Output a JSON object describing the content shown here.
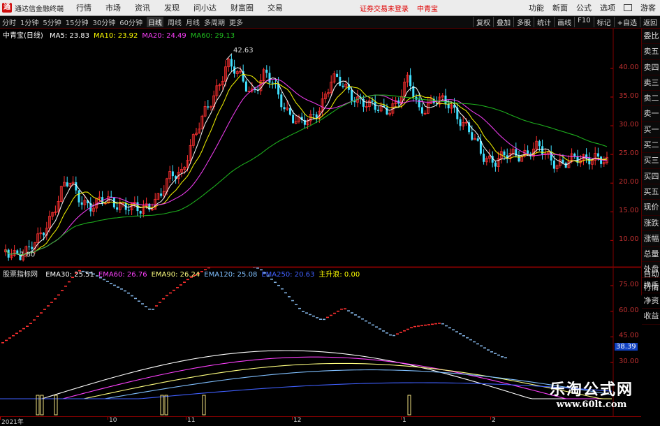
{
  "menubar": {
    "app_title": "通达信金融终端",
    "items": [
      "行情",
      "市场",
      "资讯",
      "发现",
      "问小达",
      "财富圈",
      "交易"
    ],
    "notice": "证券交易未登录",
    "stock": "中青宝",
    "right": [
      "功能",
      "新面",
      "公式",
      "选项",
      "",
      "游客"
    ]
  },
  "periodbar": {
    "periods": [
      "分时",
      "1分钟",
      "5分钟",
      "15分钟",
      "30分钟",
      "60分钟",
      "日线",
      "周线",
      "月线",
      "多周期",
      "更多"
    ],
    "active": "日线",
    "tools": [
      "复权",
      "叠加",
      "多股",
      "统计",
      "画线",
      "F10",
      "标记",
      "+自选",
      "返回"
    ]
  },
  "main_chart": {
    "title": "中青宝(日线)",
    "ma_labels": [
      {
        "text": "MA5: 23.83",
        "color": "#ffffff"
      },
      {
        "text": "MA10: 23.92",
        "color": "#ffff00"
      },
      {
        "text": "MA20: 24.49",
        "color": "#ff40ff"
      },
      {
        "text": "MA60: 29.13",
        "color": "#20c020"
      }
    ],
    "y_ticks": [
      "40.00",
      "35.00",
      "30.00",
      "25.00",
      "20.00",
      "15.00",
      "10.00"
    ],
    "high_label": "42.63",
    "low_label": "7.80"
  },
  "sub_chart": {
    "title": "股票指标网",
    "labels": [
      {
        "text": "EMA30: 25.51",
        "color": "#ffffff"
      },
      {
        "text": "EMA60: 26.76",
        "color": "#ff40ff"
      },
      {
        "text": "EMA90: 26.24",
        "color": "#ffff80"
      },
      {
        "text": "EMA120: 25.08",
        "color": "#80c0ff"
      },
      {
        "text": "EMA250: 20.63",
        "color": "#4060ff"
      },
      {
        "text": "主升浪: 0.00",
        "color": "#ffff00"
      }
    ],
    "y_ticks": [
      "75.00",
      "60.00",
      "45.00",
      "30.00"
    ],
    "current_value": "38.39"
  },
  "side_tabs": [
    "委比",
    "卖五",
    "卖四",
    "卖三",
    "卖二",
    "卖一",
    "买一",
    "买二",
    "买三",
    "买四",
    "买五",
    "现价",
    "涨跌",
    "涨幅",
    "总量",
    "外盘",
    "换手",
    "净资",
    "收益"
  ],
  "side_tabs2": [
    "自动",
    "行情"
  ],
  "dates": [
    "2021年",
    "10",
    "11",
    "12",
    "1",
    "2"
  ],
  "watermark": {
    "line1": "乐淘公式网",
    "line2": "www.60lt.com"
  },
  "colors": {
    "up": "#ff3030",
    "down": "#40e0ff",
    "ma60": "#20c020"
  }
}
